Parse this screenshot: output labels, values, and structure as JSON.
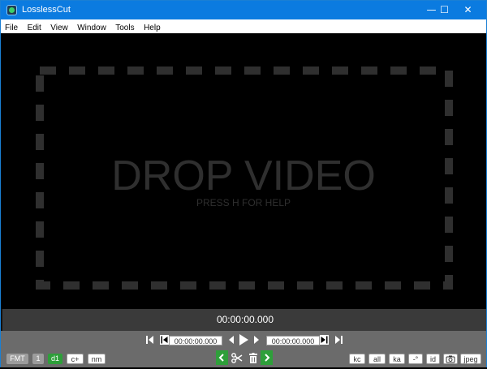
{
  "window": {
    "title": "LosslessCut",
    "minimize_glyph": "—",
    "maximize_glyph": "☐",
    "close_glyph": "✕"
  },
  "menu": {
    "items": [
      {
        "label": "File"
      },
      {
        "label": "Edit"
      },
      {
        "label": "View"
      },
      {
        "label": "Window"
      },
      {
        "label": "Tools"
      },
      {
        "label": "Help"
      }
    ]
  },
  "stage": {
    "title": "DROP VIDEO",
    "subtitle": "PRESS H FOR HELP"
  },
  "timeline": {
    "current_time": "00:00:00.000"
  },
  "controls": {
    "cut_start_time": "00:00:00.000",
    "cut_end_time": "00:00:00.000",
    "left_buttons": {
      "format": "FMT",
      "track": "1",
      "d1": "d1",
      "c_plus": "c+",
      "nm": "nm"
    },
    "right_buttons": {
      "kc": "kc",
      "all": "all",
      "ka": "ka",
      "offset": "-°",
      "id": "id",
      "jpeg": "jpeg"
    },
    "icons": {
      "jump_start": "jump-to-start-icon",
      "set_cut_start": "set-cut-start-icon",
      "prev_frame": "previous-frame-icon",
      "play": "play-icon",
      "next_frame": "next-frame-icon",
      "set_cut_end": "set-cut-end-icon",
      "jump_end": "jump-to-end-icon",
      "segment_prev": "chevron-left-icon",
      "cut": "scissors-icon",
      "delete": "trash-icon",
      "segment_next": "chevron-right-icon",
      "screenshot": "camera-icon"
    }
  },
  "colors": {
    "titlebar": "#0b7be0",
    "green_accent": "#2e9f3a",
    "stage_text": "#2f2f2f",
    "controls_bg": "#6b6b6b"
  }
}
